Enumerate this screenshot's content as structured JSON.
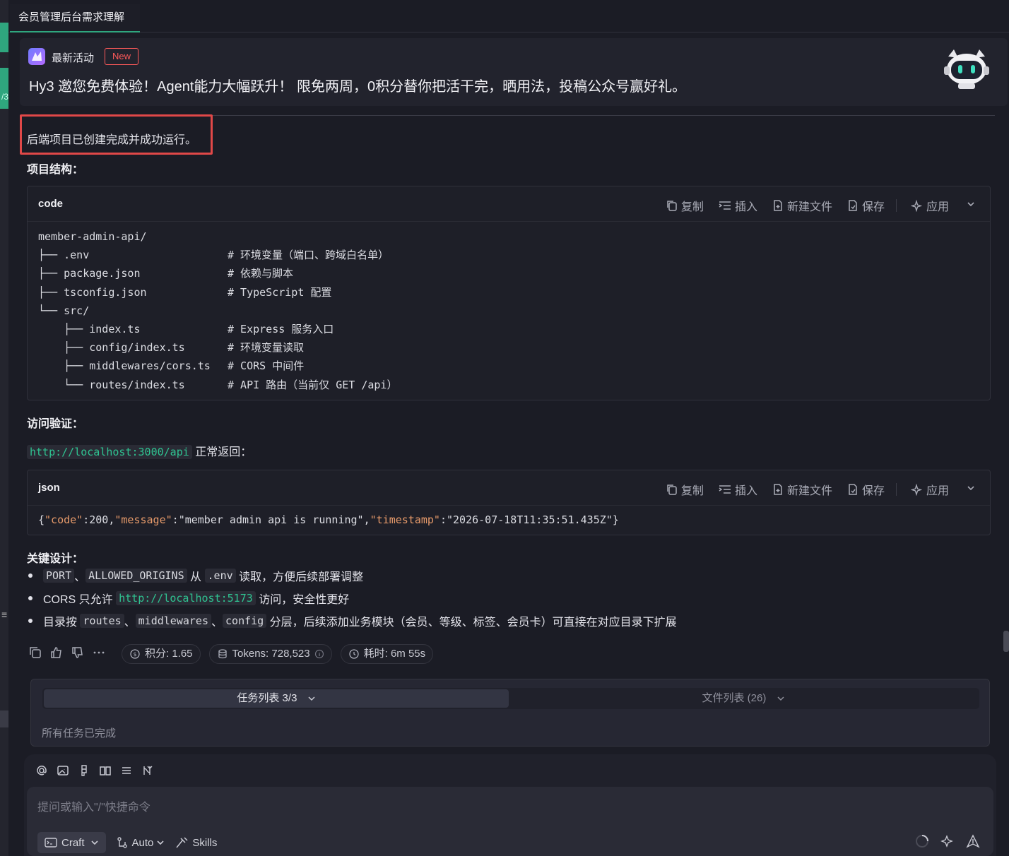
{
  "tab": {
    "title": "会员管理后台需求理解"
  },
  "banner": {
    "title": "最新活动",
    "badge": "New",
    "text": "Hy3 邀您免费体验！Agent能力大幅跃升！ 限免两周，0积分替你把活干完，晒用法，投稿公众号赢好礼。"
  },
  "message": {
    "highlight": "后端项目已创建完成并成功运行。",
    "structure_heading": "项目结构：",
    "verify_heading": "访问验证：",
    "verify_url": "http://localhost:3000/api",
    "verify_suffix": " 正常返回：",
    "design_heading": "关键设计："
  },
  "actions": {
    "copy": "复制",
    "insert": "插入",
    "newfile": "新建文件",
    "save": "保存",
    "apply": "应用"
  },
  "code_tree": {
    "lang": "code",
    "rows": [
      {
        "text": "member-admin-api/",
        "comment": ""
      },
      {
        "text": "├── .env",
        "comment": "# 环境变量（端口、跨域白名单）"
      },
      {
        "text": "├── package.json",
        "comment": "# 依赖与脚本"
      },
      {
        "text": "├── tsconfig.json",
        "comment": "# TypeScript 配置"
      },
      {
        "text": "└── src/",
        "comment": ""
      },
      {
        "text": "    ├── index.ts",
        "comment": "# Express 服务入口"
      },
      {
        "text": "    ├── config/index.ts",
        "comment": "# 环境变量读取"
      },
      {
        "text": "    ├── middlewares/cors.ts",
        "comment": "# CORS 中间件"
      },
      {
        "text": "    └── routes/index.ts",
        "comment": "# API 路由（当前仅 GET /api）"
      }
    ]
  },
  "json_block": {
    "lang": "json",
    "p1": "{",
    "k1": "\"code\"",
    "c1": ":",
    "v1": "200",
    "s1": ",",
    "k2": "\"message\"",
    "c2": ":",
    "v2": "\"member admin api is running\"",
    "s2": ",",
    "k3": "\"timestamp\"",
    "c3": ":",
    "v3": "\"2026-07-18T11:35:51.435Z\"",
    "p2": "}"
  },
  "bullets": {
    "b1": {
      "c1": "PORT",
      "sep": "、",
      "c2": "ALLOWED_ORIGINS",
      "mid": " 从 ",
      "c3": ".env",
      "tail": " 读取，方便后续部署调整"
    },
    "b2": {
      "pre": "CORS 只允许 ",
      "c1": "http://localhost:5173",
      "tail": " 访问，安全性更好"
    },
    "b3": {
      "pre": "目录按 ",
      "c1": "routes",
      "sep1": "、",
      "c2": "middlewares",
      "sep2": "、",
      "c3": "config",
      "tail": " 分层，后续添加业务模块（会员、等级、标签、会员卡）可直接在对应目录下扩展"
    }
  },
  "stats": {
    "points": "积分: 1.65",
    "tokens": "Tokens: 728,523",
    "time": "耗时: 6m 55s"
  },
  "tasks": {
    "tab1": "任务列表 3/3",
    "tab2": "文件列表 (26)",
    "status": "所有任务已完成"
  },
  "composer": {
    "placeholder": "提问或输入\"/\"快捷命令",
    "mode": "Craft",
    "auto": "Auto",
    "skills": "Skills"
  },
  "gutter": {
    "label": "/3",
    "glyph": "≡"
  },
  "colors": {
    "accent": "#2fa67e",
    "highlight_border": "#e04848",
    "link": "#2fc391",
    "badge": "#ff5a5a"
  }
}
